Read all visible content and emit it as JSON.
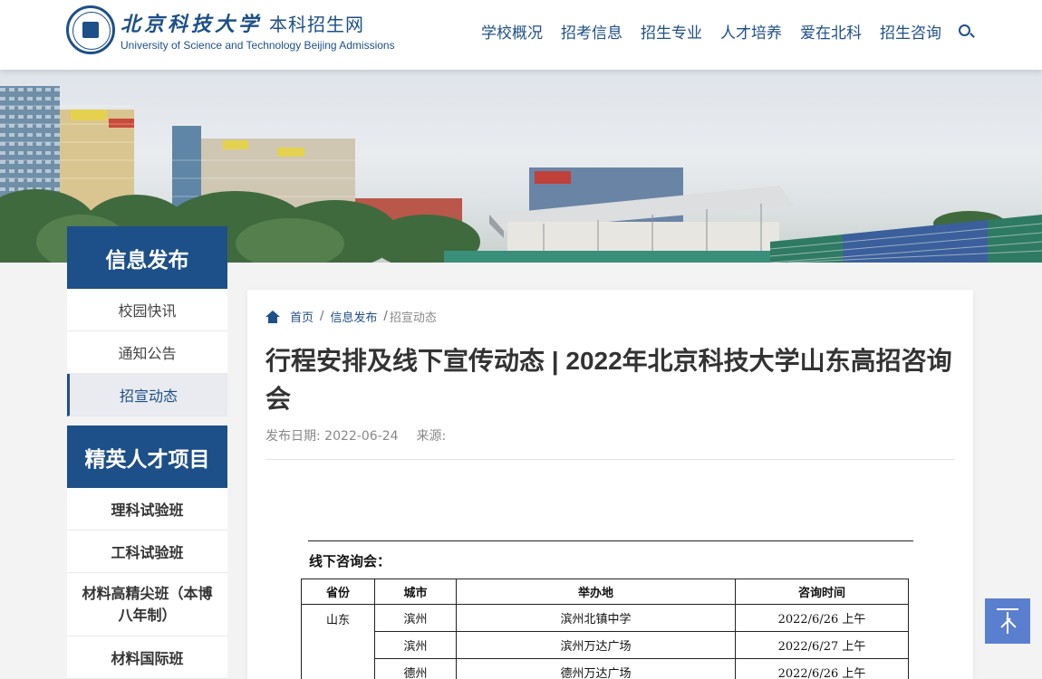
{
  "header": {
    "logo_cn": "北京科技大学",
    "logo_site": "本科招生网",
    "logo_en": "University of Science and Technology Beijing Admissions",
    "nav": [
      "学校概况",
      "招考信息",
      "招生专业",
      "人才培养",
      "爱在北科",
      "招生咨询"
    ],
    "search_icon": "search-icon"
  },
  "sidebar": {
    "section1": {
      "title": "信息发布",
      "items": [
        "校园快讯",
        "通知公告",
        "招宣动态"
      ],
      "active_index": 2
    },
    "section2": {
      "title": "精英人才项目",
      "items": [
        "理科试验班",
        "工科试验班",
        "材料高精尖班（本博八年制）",
        "材料国际班"
      ]
    }
  },
  "breadcrumb": {
    "home": "首页",
    "sep": "/",
    "section": "信息发布",
    "current": "招宣动态"
  },
  "article": {
    "title": "行程安排及线下宣传动态 | 2022年北京科技大学山东高招咨询会",
    "date_label": "发布日期: 2022-06-24",
    "source_label": "来源:"
  },
  "doc": {
    "label": "线下咨询会：",
    "headers": [
      "省份",
      "城市",
      "举办地",
      "咨询时间"
    ],
    "province": "山东",
    "rows": [
      {
        "city": "滨州",
        "venue": "滨州北镇中学",
        "time": "2022/6/26 上午"
      },
      {
        "city": "滨州",
        "venue": "滨州万达广场",
        "time": "2022/6/27 上午"
      },
      {
        "city": "德州",
        "venue": "德州万达广场",
        "time": "2022/6/26 上午"
      }
    ]
  },
  "colors": {
    "brand": "#1d4f89",
    "back_to_top": "#5a7fcf"
  }
}
